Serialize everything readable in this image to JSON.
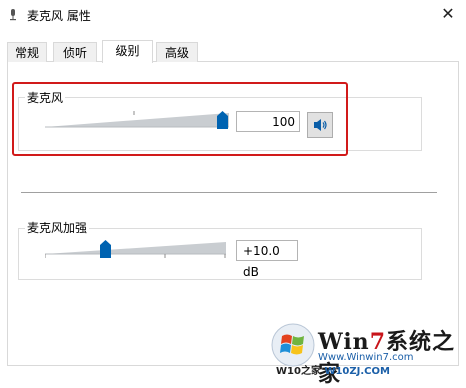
{
  "window": {
    "title": "麦克风 属性",
    "close_label": "✕"
  },
  "tabs": [
    {
      "label": "常规",
      "active": false
    },
    {
      "label": "侦听",
      "active": false
    },
    {
      "label": "级别",
      "active": true
    },
    {
      "label": "高级",
      "active": false
    }
  ],
  "microphone": {
    "label": "麦克风",
    "value_text": "100",
    "level_fraction": 1.0
  },
  "boost": {
    "label": "麦克风加强",
    "value_text": "+10.0 dB",
    "level_fraction": 0.33
  },
  "watermark": {
    "brand_main": "Win7系统之家",
    "brand_win": "Win",
    "brand_seven": "7",
    "brand_zh": "系统之家",
    "url": "Www.Winwin7.com",
    "bottom_prefix": "W10之家",
    "bottom_url": "W10ZJ.COM"
  },
  "colors": {
    "highlight_border": "#d11a1a",
    "thumb": "#0063b1",
    "track": "#c8ccd0"
  }
}
